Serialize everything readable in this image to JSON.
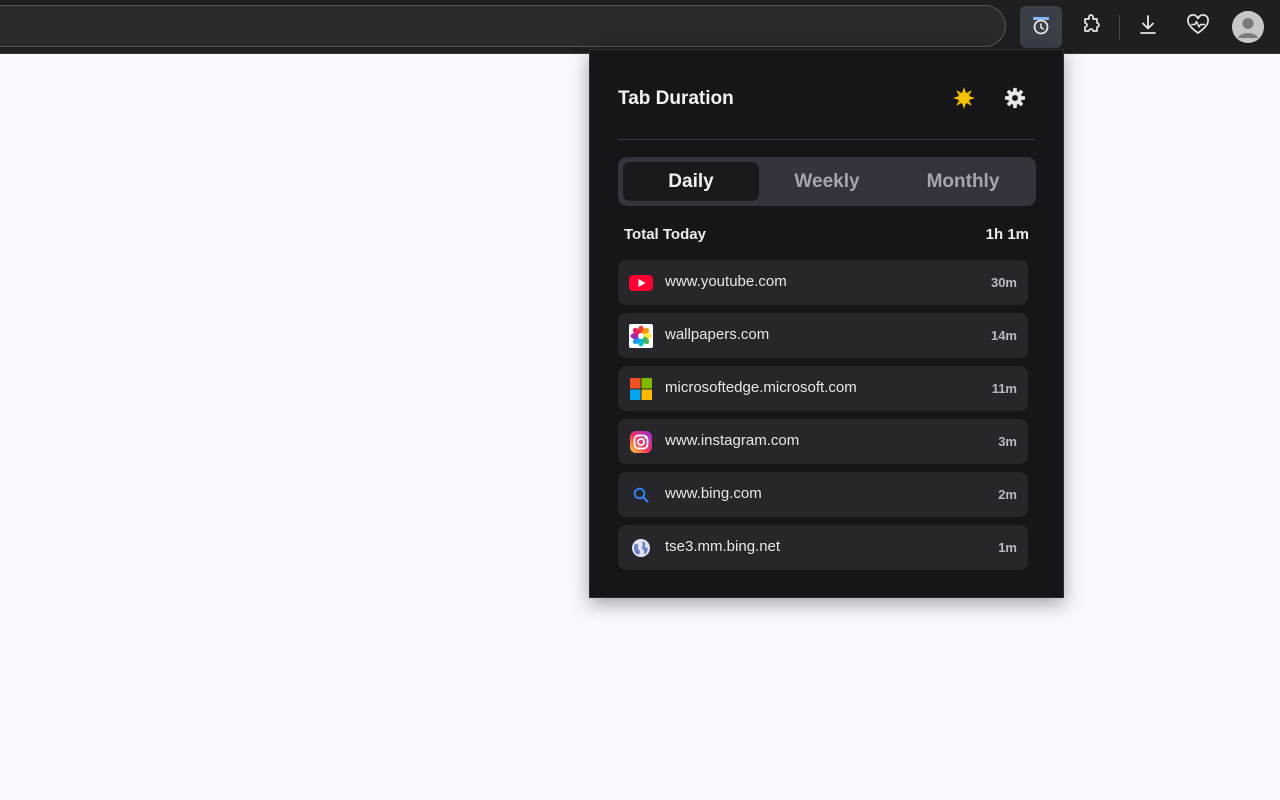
{
  "toolbar": {
    "icons": [
      "tab-duration-extension-icon",
      "extensions-puzzle-icon",
      "download-icon",
      "browser-health-icon",
      "profile-avatar-icon"
    ]
  },
  "popup": {
    "title": "Tab Duration",
    "header_icons": [
      "sun-theme-icon",
      "gear-icon"
    ],
    "tabs": [
      {
        "label": "Daily",
        "selected": true
      },
      {
        "label": "Weekly",
        "selected": false
      },
      {
        "label": "Monthly",
        "selected": false
      }
    ],
    "total": {
      "label": "Total Today",
      "value": "1h 1m"
    },
    "sites": [
      {
        "domain": "www.youtube.com",
        "duration": "30m",
        "icon": "youtube-icon"
      },
      {
        "domain": "wallpapers.com",
        "duration": "14m",
        "icon": "wallpapers-icon"
      },
      {
        "domain": "microsoftedge.microsoft.com",
        "duration": "11m",
        "icon": "microsoft-icon"
      },
      {
        "domain": "www.instagram.com",
        "duration": "3m",
        "icon": "instagram-icon"
      },
      {
        "domain": "www.bing.com",
        "duration": "2m",
        "icon": "bing-search-icon"
      },
      {
        "domain": "tse3.mm.bing.net",
        "duration": "1m",
        "icon": "globe-icon"
      }
    ]
  },
  "colors": {
    "popup_bg": "#16161a",
    "row_bg": "#26262b",
    "accent_sun": "#f5c400"
  }
}
